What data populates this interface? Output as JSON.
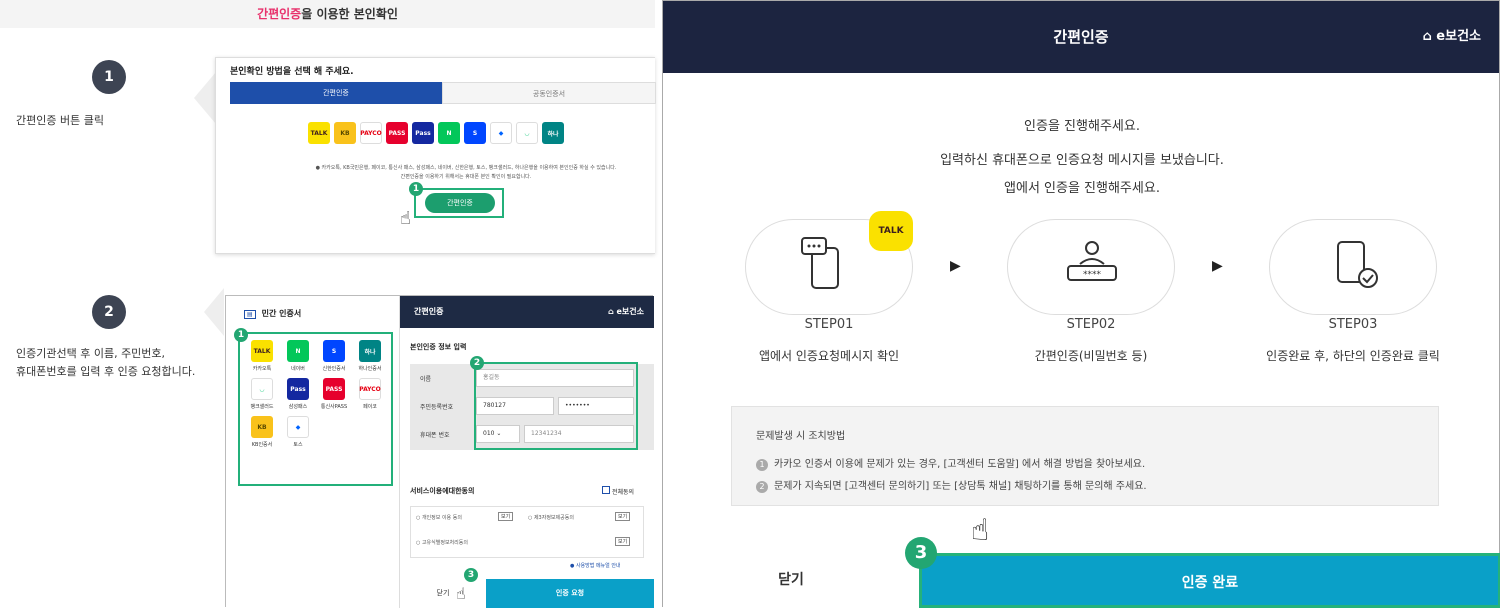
{
  "left_header": {
    "title_highlight": "간편인증",
    "title_rest": "을 이용한 본인확인"
  },
  "step1": {
    "number": "1",
    "text": "간편인증 버튼 클릭",
    "panel": {
      "heading": "본인확인 방법을 선택 해 주세요.",
      "tab_simple": "간편인증",
      "tab_public": "공동인증서",
      "icons": [
        {
          "name": "kakaotalk-icon",
          "label": "TALK",
          "bg": "#fae100",
          "fg": "#3c1e1e"
        },
        {
          "name": "kb-icon",
          "label": "KB",
          "bg": "#f9c21b",
          "fg": "#5a4a00"
        },
        {
          "name": "payco-icon",
          "label": "PAYCO",
          "bg": "#ffffff",
          "fg": "#e60012"
        },
        {
          "name": "pass-icon",
          "label": "PASS",
          "bg": "#e6002d",
          "fg": "#ffffff"
        },
        {
          "name": "samsung-pass-icon",
          "label": "Pass",
          "bg": "#1428a0",
          "fg": "#ffffff"
        },
        {
          "name": "naver-icon",
          "label": "N",
          "bg": "#03c75a",
          "fg": "#ffffff"
        },
        {
          "name": "shinhan-icon",
          "label": "S",
          "bg": "#0046ff",
          "fg": "#ffffff"
        },
        {
          "name": "toss-icon",
          "label": "◆",
          "bg": "#ffffff",
          "fg": "#0064ff"
        },
        {
          "name": "banksalad-icon",
          "label": "◡",
          "bg": "#ffffff",
          "fg": "#00c471"
        },
        {
          "name": "hana-icon",
          "label": "하나",
          "bg": "#008485",
          "fg": "#ffffff"
        }
      ],
      "note_line1": "● 카카오톡, KB국민은행, 페이코, 통신사 패스, 삼성패스, 네이버, 신한은행, 토스, 뱅크샐러드, 하나은행을 이용하여 본인인증 하실 수 있습니다.",
      "note_line2": "간편인증을 이용하기 위해서는 휴대폰 본인 확인이 필요합니다.",
      "button": "간편인증",
      "marker": "1"
    }
  },
  "step2": {
    "number": "2",
    "text_line1": "인증기관선택 후 이름, 주민번호,",
    "text_line2": "휴대폰번호를 입력 후 인증 요청합니다.",
    "left_title": "민간 인증서",
    "providers": [
      {
        "name": "kakao-provider",
        "label": "카카오톡",
        "mark": "TALK",
        "bg": "#fae100",
        "fg": "#3c1e1e"
      },
      {
        "name": "naver-provider",
        "label": "네이버",
        "mark": "N",
        "bg": "#03c75a",
        "fg": "#ffffff"
      },
      {
        "name": "shinhan-provider",
        "label": "신한인증서",
        "mark": "S",
        "bg": "#0046ff",
        "fg": "#ffffff"
      },
      {
        "name": "hana-provider",
        "label": "하나인증서",
        "mark": "하나",
        "bg": "#008485",
        "fg": "#ffffff"
      },
      {
        "name": "banksalad-provider",
        "label": "뱅크샐러드",
        "mark": "◡",
        "bg": "#ffffff",
        "fg": "#00c471"
      },
      {
        "name": "samsungpass-provider",
        "label": "삼성패스",
        "mark": "Pass",
        "bg": "#1428a0",
        "fg": "#ffffff"
      },
      {
        "name": "pass-provider",
        "label": "통신사PASS",
        "mark": "PASS",
        "bg": "#e6002d",
        "fg": "#ffffff"
      },
      {
        "name": "payco-provider",
        "label": "페이코",
        "mark": "PAYCO",
        "bg": "#ffffff",
        "fg": "#e60012"
      },
      {
        "name": "kb-provider",
        "label": "KB인증서",
        "mark": "KB",
        "bg": "#f9c21b",
        "fg": "#5a4a00"
      },
      {
        "name": "toss-provider",
        "label": "토스",
        "mark": "◆",
        "bg": "#ffffff",
        "fg": "#0064ff"
      }
    ],
    "right_title": "간편인증",
    "brand": "e보건소",
    "section_title": "본인인증 정보 입력",
    "name_label": "이름",
    "name_value": "홍길동",
    "rrn_label": "주민등록번호",
    "rrn_front": "780127",
    "rrn_back": "•••••••",
    "phone_label": "휴대폰 번호",
    "phone_prefix": "010",
    "phone_value": "12341234",
    "agree_title": "서비스이용에대한동의",
    "agree_all": "전체동의",
    "agree1": "개인정보 이용 동의",
    "agree2": "제3자정보제공동의",
    "agree3": "고유식별정보처리동의",
    "view": "보기",
    "manual": "사용방법 메뉴얼 안내",
    "close": "닫기",
    "request": "인증 요청",
    "marker1": "1",
    "marker2": "2",
    "marker3": "3"
  },
  "right_panel": {
    "title": "간편인증",
    "brand": "e보건소",
    "msg1": "인증을 진행해주세요.",
    "msg2": "입력하신 휴대폰으로 인증요청 메시지를 보냈습니다.",
    "msg3": "앱에서 인증을 진행해주세요.",
    "talk_badge": "TALK",
    "steps": [
      {
        "name": "STEP01",
        "desc": "앱에서 인증요청메시지 확인"
      },
      {
        "name": "STEP02",
        "desc": "간편인증(비밀번호 등)"
      },
      {
        "name": "STEP03",
        "desc": "인증완료 후, 하단의 인증완료 클릭"
      }
    ],
    "trouble_title": "문제발생 시 조치방법",
    "trouble1_num": "1",
    "trouble1": "카카오 인증서 이용에 문제가 있는 경우, [고객센터 도움말] 에서 해결 방법을 찾아보세요.",
    "trouble2_num": "2",
    "trouble2": "문제가 지속되면 [고객센터 문의하기] 또는 [상담톡 채널] 채팅하기를 통해 문의해 주세요.",
    "close": "닫기",
    "done": "인증 완료",
    "marker": "3"
  }
}
